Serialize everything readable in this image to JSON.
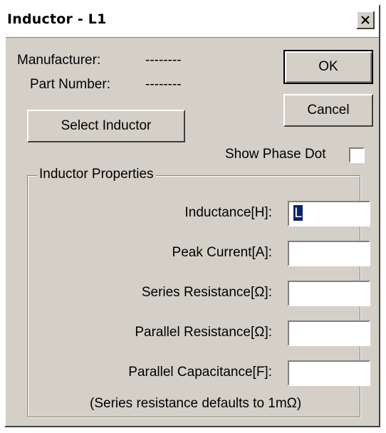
{
  "window": {
    "title": "Inductor - L1"
  },
  "info": {
    "manufacturer_label": "Manufacturer:",
    "manufacturer_value": "--------",
    "part_number_label": "Part Number:",
    "part_number_value": "--------"
  },
  "buttons": {
    "ok": "OK",
    "cancel": "Cancel",
    "select_inductor": "Select Inductor"
  },
  "show_phase_dot": {
    "label": "Show Phase Dot",
    "checked": false
  },
  "properties": {
    "group_title": "Inductor Properties",
    "fields": [
      {
        "label": "Inductance[H]:",
        "value": "L"
      },
      {
        "label": "Peak Current[A]:",
        "value": ""
      },
      {
        "label": "Series Resistance[Ω]:",
        "value": ""
      },
      {
        "label": "Parallel Resistance[Ω]:",
        "value": ""
      },
      {
        "label": "Parallel Capacitance[F]:",
        "value": ""
      }
    ],
    "note": "(Series resistance defaults to 1mΩ)"
  },
  "icons": {
    "close": "close-icon"
  }
}
